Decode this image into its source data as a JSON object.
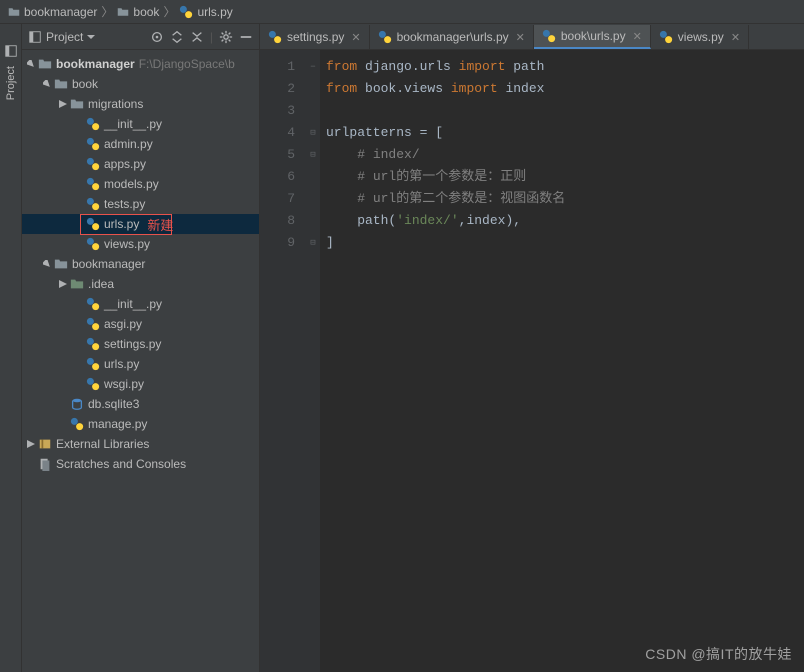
{
  "breadcrumb": {
    "items": [
      "bookmanager",
      "book",
      "urls.py"
    ]
  },
  "left_gutter": {
    "project_label": "Project"
  },
  "sidebar": {
    "title": "Project",
    "tree": {
      "root": {
        "label": "bookmanager",
        "path": "F:\\DjangoSpace\\b"
      },
      "book": {
        "label": "book"
      },
      "migrations": {
        "label": "migrations"
      },
      "files_book": [
        "__init__.py",
        "admin.py",
        "apps.py",
        "models.py",
        "tests.py",
        "urls.py",
        "views.py"
      ],
      "annotation_new": "新建",
      "bookmanager_folder": {
        "label": "bookmanager"
      },
      "idea": {
        "label": ".idea"
      },
      "files_bm": [
        "__init__.py",
        "asgi.py",
        "settings.py",
        "urls.py",
        "wsgi.py"
      ],
      "db": "db.sqlite3",
      "manage": "manage.py",
      "external": "External Libraries",
      "scratches": "Scratches and Consoles"
    }
  },
  "tabs": {
    "items": [
      {
        "label": "settings.py",
        "active": false
      },
      {
        "label": "bookmanager\\urls.py",
        "active": false
      },
      {
        "label": "book\\urls.py",
        "active": true
      },
      {
        "label": "views.py",
        "active": false
      }
    ]
  },
  "code": {
    "lines": [
      {
        "n": 1,
        "fold": "−",
        "seg": [
          [
            "kw",
            "from"
          ],
          [
            "ident",
            " django.urls "
          ],
          [
            "kw",
            "import"
          ],
          [
            "ident",
            " path"
          ]
        ]
      },
      {
        "n": 2,
        "fold": "",
        "seg": [
          [
            "kw",
            "from"
          ],
          [
            "ident",
            " book.views "
          ],
          [
            "kw",
            "import"
          ],
          [
            "ident",
            " index"
          ]
        ]
      },
      {
        "n": 3,
        "fold": "",
        "seg": []
      },
      {
        "n": 4,
        "fold": "⊟",
        "seg": [
          [
            "ident",
            "urlpatterns "
          ],
          [
            "op",
            "= ["
          ]
        ]
      },
      {
        "n": 5,
        "fold": "⊟",
        "seg": [
          [
            "ident",
            "    "
          ],
          [
            "comment",
            "# index/"
          ]
        ]
      },
      {
        "n": 6,
        "fold": "",
        "seg": [
          [
            "ident",
            "    "
          ],
          [
            "comment",
            "# url的第一个参数是：正则"
          ]
        ]
      },
      {
        "n": 7,
        "fold": "",
        "seg": [
          [
            "ident",
            "    "
          ],
          [
            "comment",
            "# url的第二个参数是：视图函数名"
          ]
        ]
      },
      {
        "n": 8,
        "fold": "",
        "seg": [
          [
            "ident",
            "    path("
          ],
          [
            "str",
            "'index/'"
          ],
          [
            "op",
            ","
          ],
          [
            "ident",
            "index),"
          ]
        ]
      },
      {
        "n": 9,
        "fold": "⊟",
        "seg": [
          [
            "op",
            "]"
          ]
        ]
      }
    ]
  },
  "watermark": "CSDN @搞IT的放牛娃"
}
